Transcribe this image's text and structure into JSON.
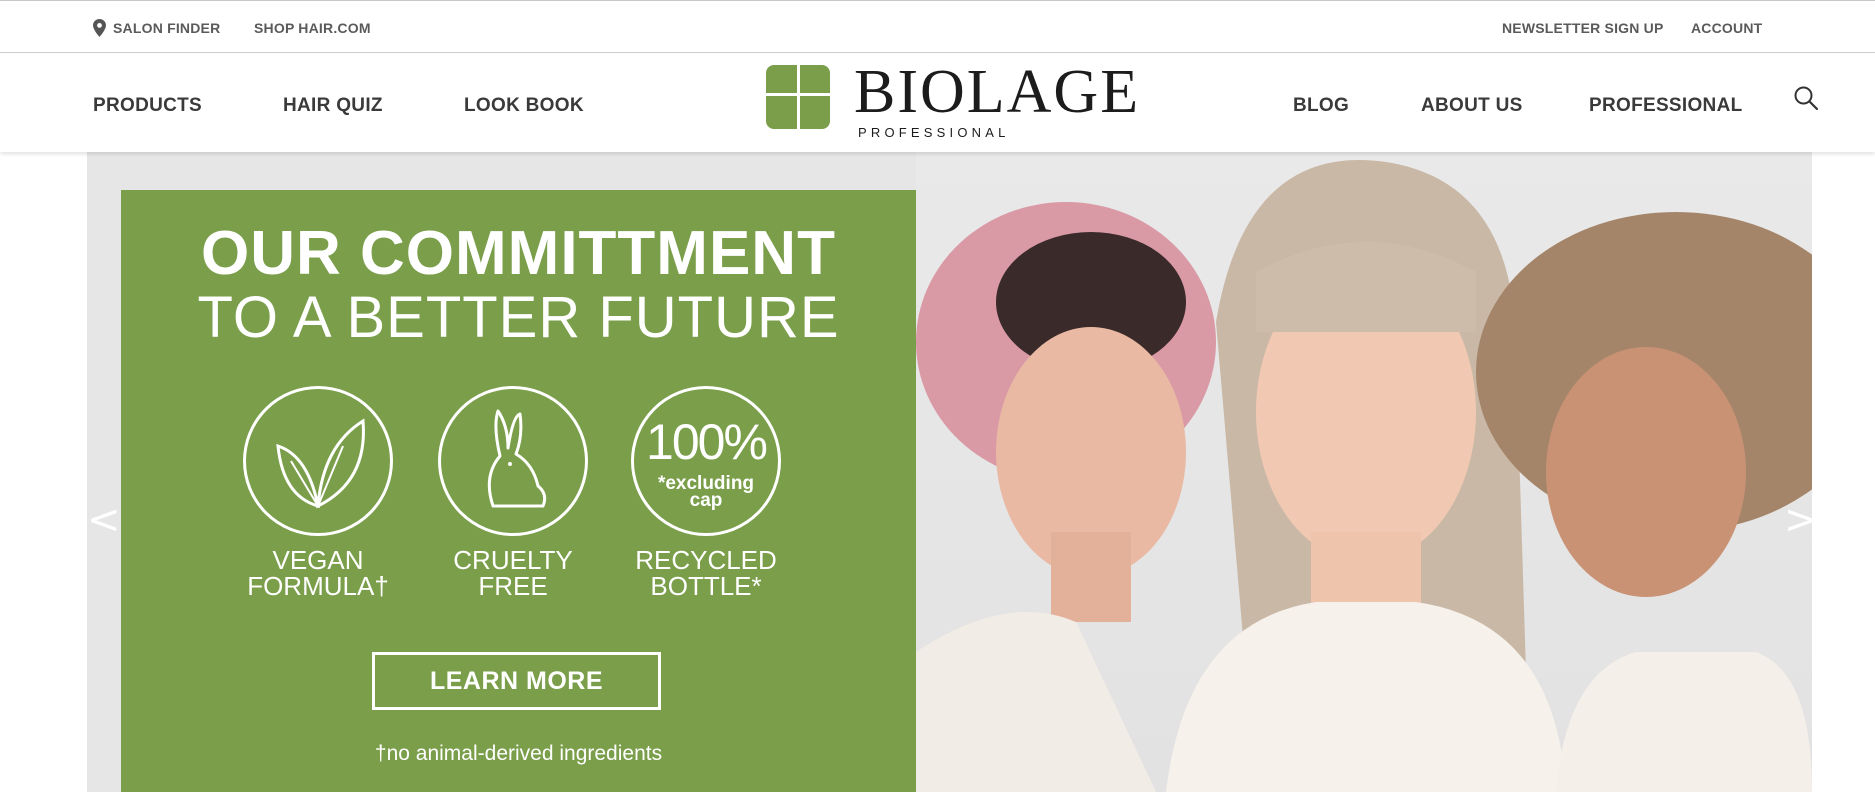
{
  "utility": {
    "salon_finder": "SALON FINDER",
    "shop": "SHOP HAIR.COM",
    "newsletter": "NEWSLETTER SIGN UP",
    "account": "ACCOUNT"
  },
  "nav": {
    "left": [
      "PRODUCTS",
      "HAIR QUIZ",
      "LOOK BOOK"
    ],
    "right": [
      "BLOG",
      "ABOUT US",
      "PROFESSIONAL"
    ]
  },
  "logo": {
    "word": "BIOLAGE",
    "sub": "PROFESSIONAL",
    "color": "#7a9e4a"
  },
  "icons": {
    "location": "location-pin-icon",
    "search": "search-icon"
  },
  "hero": {
    "heading_line1": "OUR COMMITTMENT",
    "heading_line2": "TO A BETTER FUTURE",
    "badges": [
      {
        "icon": "leaf-icon",
        "label_line1": "VEGAN",
        "label_line2": "FORMULA†"
      },
      {
        "icon": "rabbit-icon",
        "label_line1": "CRUELTY",
        "label_line2": "FREE"
      },
      {
        "icon": "recycle-percent-icon",
        "inner_big": "100%",
        "inner_small1": "*excluding",
        "inner_small2": "cap",
        "label_line1": "RECYCLED",
        "label_line2": "BOTTLE*"
      }
    ],
    "cta": "LEARN MORE",
    "footnote": "†no animal-derived ingredients",
    "prev_arrow": "<",
    "next_arrow": ">",
    "panel_color": "#7a9e4a"
  }
}
